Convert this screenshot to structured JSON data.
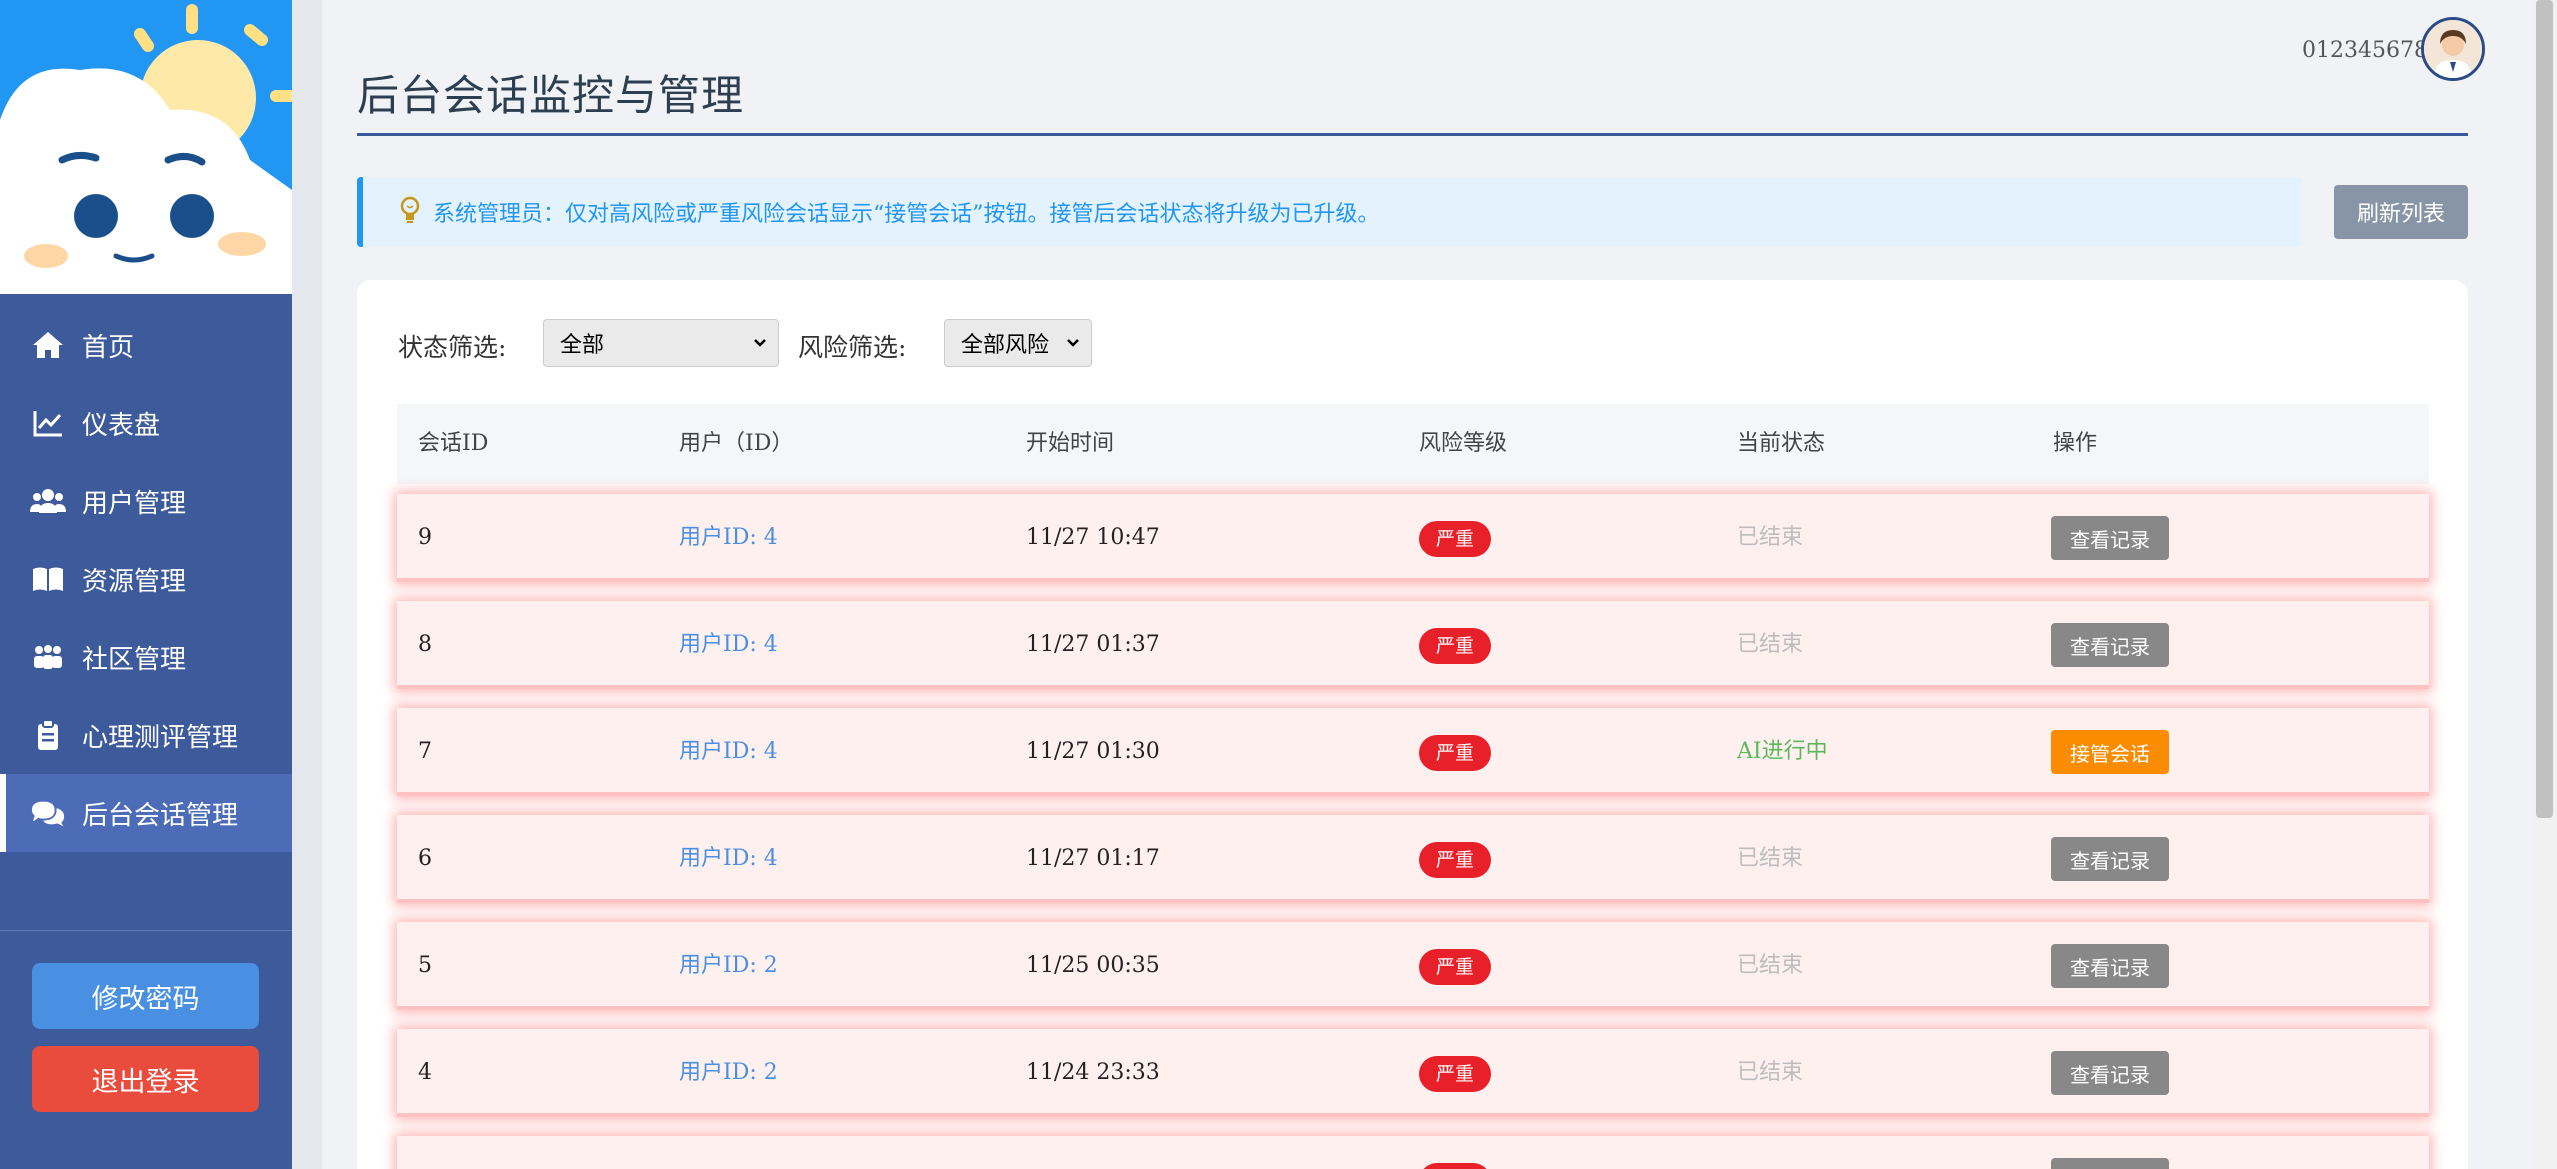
{
  "sidebar": {
    "items": [
      {
        "label": "首页",
        "icon": "home-icon"
      },
      {
        "label": "仪表盘",
        "icon": "chart-line-icon"
      },
      {
        "label": "用户管理",
        "icon": "users-icon"
      },
      {
        "label": "资源管理",
        "icon": "book-icon"
      },
      {
        "label": "社区管理",
        "icon": "community-icon"
      },
      {
        "label": "心理测评管理",
        "icon": "clipboard-icon"
      },
      {
        "label": "后台会话管理",
        "icon": "chat-icon",
        "active": true
      }
    ],
    "change_password": "修改密码",
    "logout": "退出登录"
  },
  "header": {
    "title": "后台会话监控与管理",
    "user_id": "012345678"
  },
  "notice": {
    "text": "系统管理员：仅对高风险或严重风险会话显示“接管会话”按钮。接管后会话状态将升级为已升级。",
    "refresh": "刷新列表"
  },
  "filters": {
    "status_label": "状态筛选:",
    "status_value": "全部",
    "risk_label": "风险筛选:",
    "risk_value": "全部风险"
  },
  "table": {
    "columns": [
      "会话ID",
      "用户（ID）",
      "开始时间",
      "风险等级",
      "当前状态",
      "操作"
    ],
    "rows": [
      {
        "id": "9",
        "user": "用户ID: 4",
        "time": "11/27 10:47",
        "risk": "严重",
        "status": "已结束",
        "action": "查看记录"
      },
      {
        "id": "8",
        "user": "用户ID: 4",
        "time": "11/27 01:37",
        "risk": "严重",
        "status": "已结束",
        "action": "查看记录"
      },
      {
        "id": "7",
        "user": "用户ID: 4",
        "time": "11/27 01:30",
        "risk": "严重",
        "status": "AI进行中",
        "action": "接管会话"
      },
      {
        "id": "6",
        "user": "用户ID: 4",
        "time": "11/27 01:17",
        "risk": "严重",
        "status": "已结束",
        "action": "查看记录"
      },
      {
        "id": "5",
        "user": "用户ID: 2",
        "time": "11/25 00:35",
        "risk": "严重",
        "status": "已结束",
        "action": "查看记录"
      },
      {
        "id": "4",
        "user": "用户ID: 2",
        "time": "11/24 23:33",
        "risk": "严重",
        "status": "已结束",
        "action": "查看记录"
      },
      {
        "id": "",
        "user": "",
        "time": "",
        "risk": "严重",
        "status": "",
        "action": ""
      }
    ]
  },
  "colors": {
    "sidebar": "#3d5a9a",
    "accent": "#2196f3",
    "danger": "#e8202a",
    "takeover": "#fb8c00",
    "row_bg": "#fff0f0"
  }
}
